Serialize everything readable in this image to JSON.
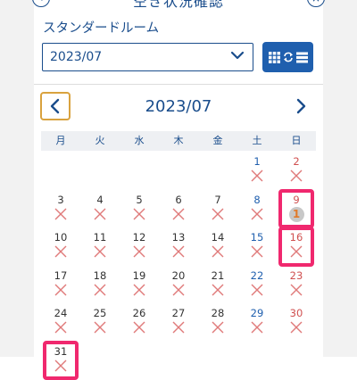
{
  "header": {
    "title": "空き状況確認",
    "left_icon": "back-circle-icon",
    "right_icon": "close-circle-icon"
  },
  "room_label": "スタンダードルーム",
  "month_select": {
    "value": "2023/07"
  },
  "view_toggle": {
    "icon": "grid-list-switch-icon"
  },
  "calendar": {
    "title": "2023/07",
    "weekdays": [
      "月",
      "火",
      "水",
      "木",
      "金",
      "土",
      "日"
    ],
    "weeks": [
      [
        "",
        "",
        "",
        "",
        "",
        "1",
        "2"
      ],
      [
        "3",
        "4",
        "5",
        "6",
        "7",
        "8",
        "9"
      ],
      [
        "10",
        "11",
        "12",
        "13",
        "14",
        "15",
        "16"
      ],
      [
        "17",
        "18",
        "19",
        "20",
        "21",
        "22",
        "23"
      ],
      [
        "24",
        "25",
        "26",
        "27",
        "28",
        "29",
        "30"
      ],
      [
        "31",
        "",
        "",
        "",
        "",
        "",
        ""
      ]
    ],
    "availability_badge": {
      "day": "9",
      "value": "1"
    },
    "highlighted_days": [
      "9",
      "16",
      "31"
    ]
  },
  "colors": {
    "accent": "#1f5fae",
    "highlight": "#f0286e",
    "unavailable": "#e07a7a",
    "prev_border": "#d9a23e"
  }
}
